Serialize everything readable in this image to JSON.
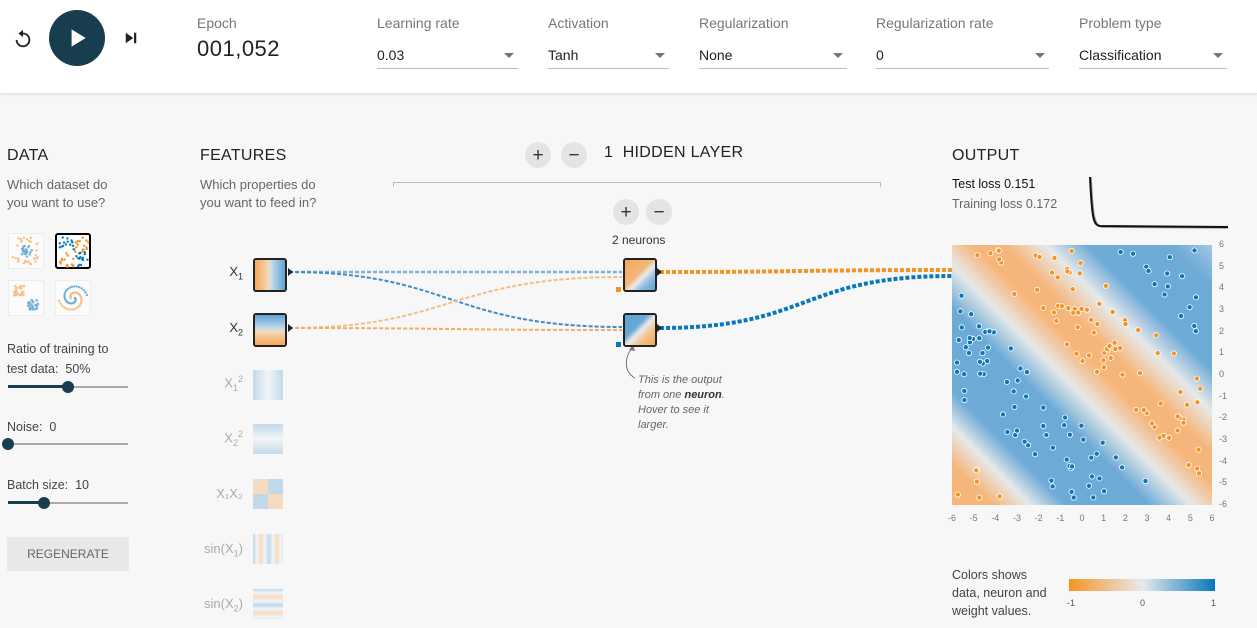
{
  "toolbar": {
    "epoch_label": "Epoch",
    "epoch_value": "001,052",
    "learning_rate": {
      "label": "Learning rate",
      "value": "0.03"
    },
    "activation": {
      "label": "Activation",
      "value": "Tanh"
    },
    "regularization": {
      "label": "Regularization",
      "value": "None"
    },
    "regularization_rate": {
      "label": "Regularization rate",
      "value": "0"
    },
    "problem_type": {
      "label": "Problem type",
      "value": "Classification"
    },
    "icons": {
      "reset": "reset-icon",
      "play": "play-icon",
      "step": "step-forward-icon"
    }
  },
  "data_panel": {
    "title": "DATA",
    "subtitle_line1": "Which dataset do",
    "subtitle_line2": "you want to use?",
    "datasets": [
      {
        "name": "circle",
        "selected": false
      },
      {
        "name": "xor",
        "selected": true
      },
      {
        "name": "gaussian",
        "selected": false
      },
      {
        "name": "spiral",
        "selected": false
      }
    ],
    "ratio": {
      "label_line1": "Ratio of training to",
      "label_line2": "test data:",
      "value": "50%",
      "level": 0.5
    },
    "noise": {
      "label": "Noise:",
      "value": "0",
      "level": 0
    },
    "batch": {
      "label": "Batch size:",
      "value": "10",
      "level": 0.3
    },
    "regenerate_label": "REGENERATE"
  },
  "features_panel": {
    "title": "FEATURES",
    "subtitle_line1": "Which properties do",
    "subtitle_line2": "you want to feed in?",
    "features": [
      {
        "base": "X",
        "sub": "1",
        "sup": "",
        "enabled": true
      },
      {
        "base": "X",
        "sub": "2",
        "sup": "",
        "enabled": true
      },
      {
        "base": "X",
        "sub": "1",
        "sup": "2",
        "enabled": false
      },
      {
        "base": "X",
        "sub": "2",
        "sup": "2",
        "enabled": false
      },
      {
        "base": "X₁X₂",
        "sub": "",
        "sup": "",
        "enabled": false
      },
      {
        "base": "sin(X",
        "sub": "1",
        "sup": "",
        "close": ")",
        "enabled": false
      },
      {
        "base": "sin(X",
        "sub": "2",
        "sup": "",
        "close": ")",
        "enabled": false
      }
    ]
  },
  "network": {
    "layers_count": "1",
    "layers_label": "HIDDEN LAYER",
    "neurons_label": "2 neurons",
    "callout": {
      "line1": "This is the output",
      "line2_pre": "from one ",
      "line2_bold": "neuron",
      "line2_post": ".",
      "line3": "Hover to see it",
      "line4": "larger."
    }
  },
  "output_panel": {
    "title": "OUTPUT",
    "test_loss": "Test loss 0.151",
    "train_loss": "Training loss 0.172",
    "y_ticks": [
      "6",
      "5",
      "4",
      "3",
      "2",
      "1",
      "0",
      "-1",
      "-2",
      "-3",
      "-4",
      "-5",
      "-6"
    ],
    "x_ticks": [
      "-6",
      "-5",
      "-4",
      "-3",
      "-2",
      "-1",
      "0",
      "1",
      "2",
      "3",
      "4",
      "5",
      "6"
    ],
    "legend_note_line1": "Colors shows",
    "legend_note_line2": "data, neuron and",
    "legend_note_line3": "weight values.",
    "legend_ticks": [
      "-1",
      "0",
      "1"
    ]
  },
  "colors": {
    "orange": "#f59322",
    "blue": "#0877bd",
    "dark": "#183d4e",
    "neutral": "#e8eaeb"
  }
}
